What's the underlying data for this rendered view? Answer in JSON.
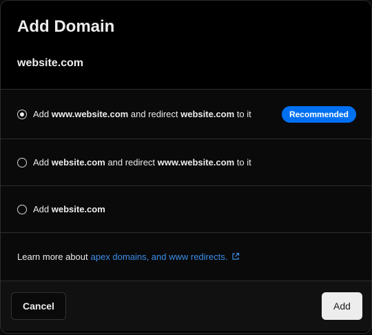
{
  "modal": {
    "title": "Add Domain",
    "domain": "website.com"
  },
  "options": [
    {
      "selected": true,
      "prefix": "Add ",
      "bold1": "www.website.com",
      "middle": " and redirect ",
      "bold2": "website.com",
      "suffix": " to it",
      "badge": "Recommended"
    },
    {
      "selected": false,
      "prefix": "Add ",
      "bold1": "website.com",
      "middle": " and redirect ",
      "bold2": "www.website.com",
      "suffix": " to it"
    },
    {
      "selected": false,
      "prefix": "Add ",
      "bold1": "website.com"
    }
  ],
  "learn_more": {
    "text": "Learn more about",
    "link": "apex domains, and www redirects."
  },
  "footer": {
    "cancel_label": "Cancel",
    "add_label": "Add"
  },
  "colors": {
    "accent": "#0070f3",
    "link": "#3b8eea",
    "background": "#000000",
    "border": "#2e2e2e"
  },
  "icons": {
    "external_link": "external-link-icon"
  }
}
